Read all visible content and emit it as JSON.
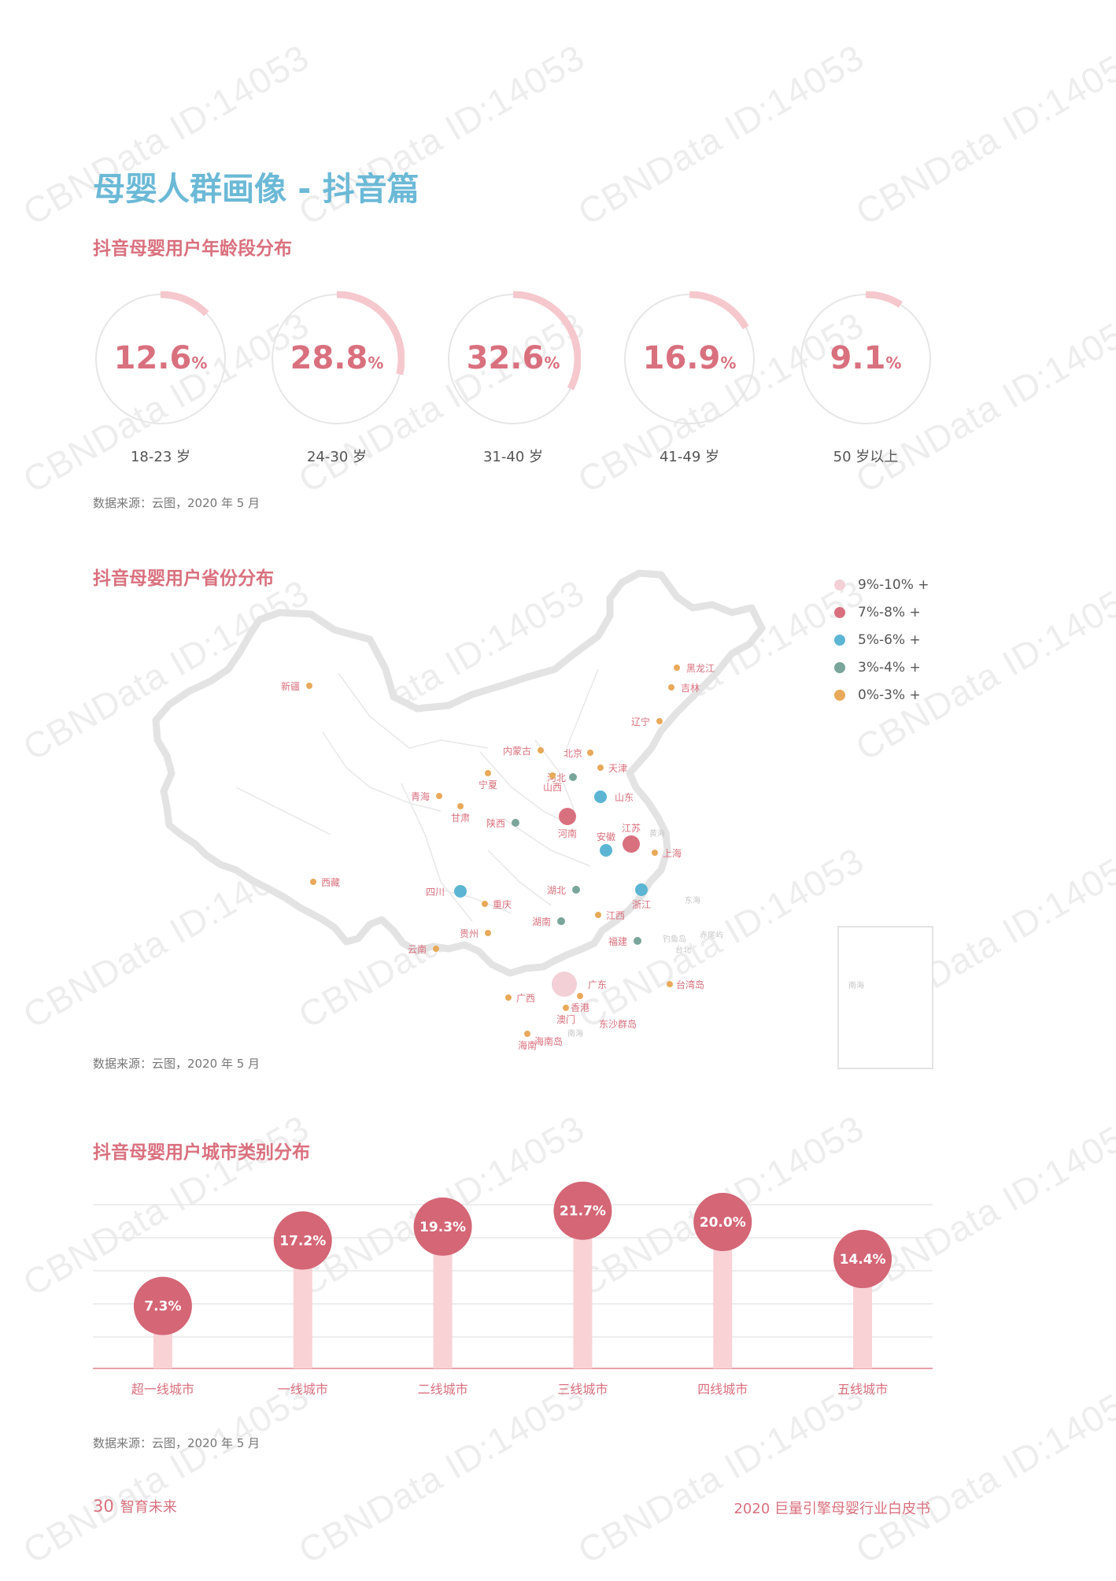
{
  "watermark": "CBNData ID:14053",
  "page_title": "母婴人群画像 - 抖音篇",
  "sections": {
    "age": {
      "title": "抖音母婴用户年龄段分布",
      "source": "数据来源：云图，2020 年 5 月"
    },
    "province": {
      "title": "抖音母婴用户省份分布",
      "source": "数据来源：云图，2020 年 5 月"
    },
    "city": {
      "title": "抖音母婴用户城市类别分布",
      "source": "数据来源：云图，2020 年 5 月"
    }
  },
  "age_groups": [
    {
      "label": "18-23 岁",
      "value": "12.6",
      "unit": "%",
      "pct": 12.6
    },
    {
      "label": "24-30 岁",
      "value": "28.8",
      "unit": "%",
      "pct": 28.8
    },
    {
      "label": "31-40 岁",
      "value": "32.6",
      "unit": "%",
      "pct": 32.6
    },
    {
      "label": "41-49 岁",
      "value": "16.9",
      "unit": "%",
      "pct": 16.9
    },
    {
      "label": "50 岁以上",
      "value": "9.1",
      "unit": "%",
      "pct": 9.1
    }
  ],
  "legend": [
    {
      "label": "9%-10% +",
      "color": "#f3d0d6"
    },
    {
      "label": "7%-8% +",
      "color": "#d9707e"
    },
    {
      "label": "5%-6% +",
      "color": "#5bb5d3"
    },
    {
      "label": "3%-4% +",
      "color": "#7aa59a"
    },
    {
      "label": "0%-3% +",
      "color": "#e8a95a"
    }
  ],
  "provinces": [
    {
      "name": "新疆",
      "tier": 4
    },
    {
      "name": "黑龙江",
      "tier": 4
    },
    {
      "name": "吉林",
      "tier": 4
    },
    {
      "name": "辽宁",
      "tier": 4
    },
    {
      "name": "内蒙古",
      "tier": 4
    },
    {
      "name": "北京",
      "tier": 4
    },
    {
      "name": "天津",
      "tier": 4
    },
    {
      "name": "河北",
      "tier": 3
    },
    {
      "name": "山西",
      "tier": 4
    },
    {
      "name": "宁夏",
      "tier": 4
    },
    {
      "name": "青海",
      "tier": 4
    },
    {
      "name": "甘肃",
      "tier": 4
    },
    {
      "name": "山东",
      "tier": 2
    },
    {
      "name": "陕西",
      "tier": 3
    },
    {
      "name": "河南",
      "tier": 1
    },
    {
      "name": "西藏",
      "tier": 4
    },
    {
      "name": "安徽",
      "tier": 2
    },
    {
      "name": "江苏",
      "tier": 1
    },
    {
      "name": "上海",
      "tier": 4
    },
    {
      "name": "四川",
      "tier": 2
    },
    {
      "name": "湖北",
      "tier": 3
    },
    {
      "name": "浙江",
      "tier": 2
    },
    {
      "name": "重庆",
      "tier": 4
    },
    {
      "name": "湖南",
      "tier": 3
    },
    {
      "name": "江西",
      "tier": 4
    },
    {
      "name": "贵州",
      "tier": 4
    },
    {
      "name": "福建",
      "tier": 3
    },
    {
      "name": "云南",
      "tier": 4
    },
    {
      "name": "广东",
      "tier": 0
    },
    {
      "name": "广西",
      "tier": 4
    },
    {
      "name": "台湾岛",
      "tier": 4
    },
    {
      "name": "香港",
      "tier": 4
    },
    {
      "name": "澳门",
      "tier": 4
    },
    {
      "name": "海南",
      "tier": 4
    }
  ],
  "map_other_labels": [
    "黄海",
    "东海",
    "台北",
    "钓鱼岛",
    "赤尾屿",
    "东沙群岛",
    "南海",
    "海南岛",
    "南海"
  ],
  "chart_data": {
    "type": "bar",
    "categories": [
      "超一线城市",
      "一线城市",
      "二线城市",
      "三线城市",
      "四线城市",
      "五线城市"
    ],
    "values": [
      7.3,
      17.2,
      19.3,
      21.7,
      20.0,
      14.4
    ],
    "labels": [
      "7.3%",
      "17.2%",
      "19.3%",
      "21.7%",
      "20.0%",
      "14.4%"
    ],
    "ylim": [
      0,
      25
    ],
    "grid": true
  },
  "footer": {
    "page_number": "30",
    "section": "智育未来",
    "report": "2020 巨量引擎母婴行业白皮书"
  }
}
